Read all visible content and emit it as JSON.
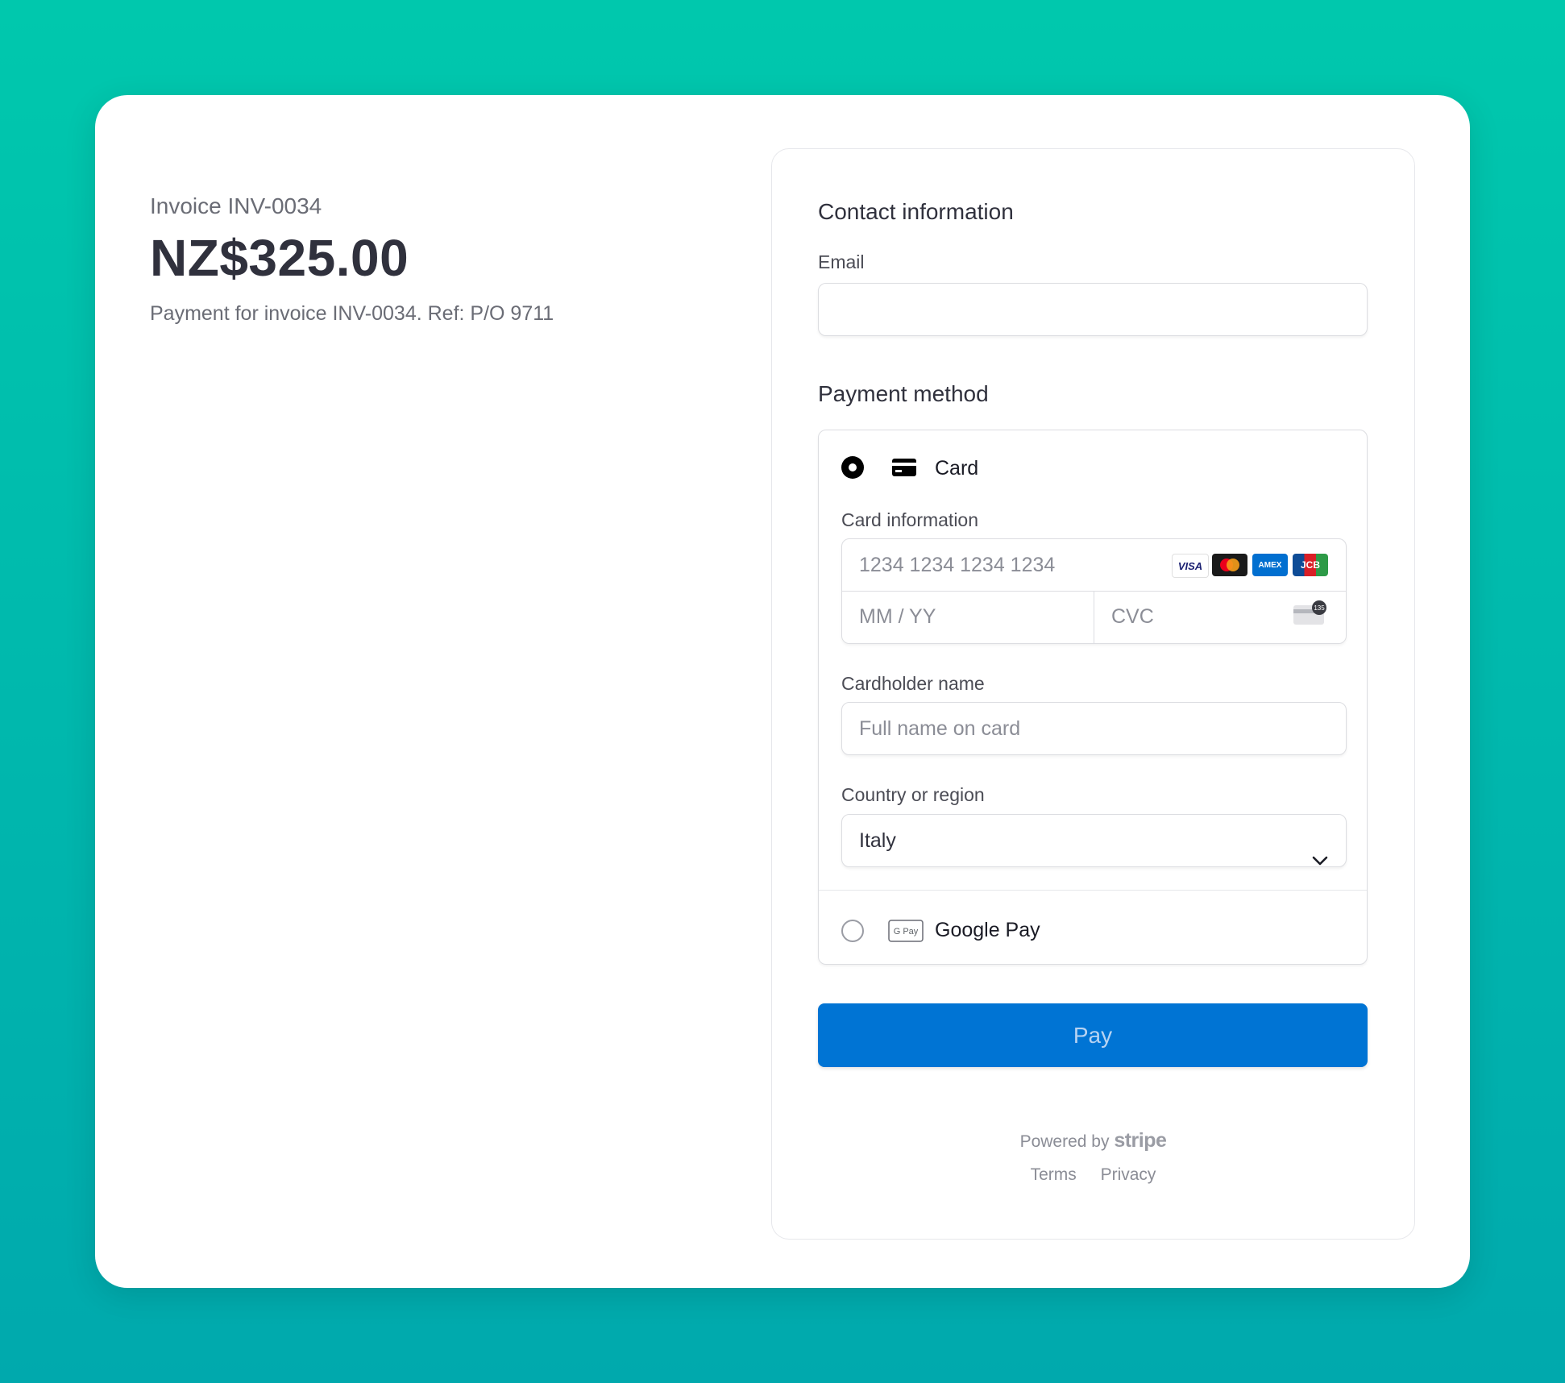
{
  "invoice": {
    "label": "Invoice INV-0034",
    "amount": "NZ$325.00",
    "description": "Payment for invoice INV-0034. Ref: P/O 9711"
  },
  "contact": {
    "title": "Contact information",
    "email_label": "Email",
    "email_value": ""
  },
  "payment": {
    "title": "Payment method",
    "card_option_label": "Card",
    "card_info_label": "Card information",
    "card_number_placeholder": "1234 1234 1234 1234",
    "expiry_placeholder": "MM / YY",
    "cvc_placeholder": "CVC",
    "card_brands": [
      "VISA",
      "mastercard",
      "AMEX",
      "JCB"
    ],
    "cvc_hint_number": "135",
    "cardholder_label": "Cardholder name",
    "cardholder_placeholder": "Full name on card",
    "country_label": "Country or region",
    "country_value": "Italy",
    "gpay_icon_text": "G Pay",
    "gpay_label": "Google Pay",
    "selected_method": "card"
  },
  "pay_button": {
    "label": "Pay"
  },
  "footer": {
    "powered_by": "Powered by",
    "brand": "stripe",
    "terms": "Terms",
    "privacy": "Privacy"
  },
  "colors": {
    "background_top": "#00c8ad",
    "background_bottom": "#00a9ad",
    "pay_button": "#0074d4"
  }
}
